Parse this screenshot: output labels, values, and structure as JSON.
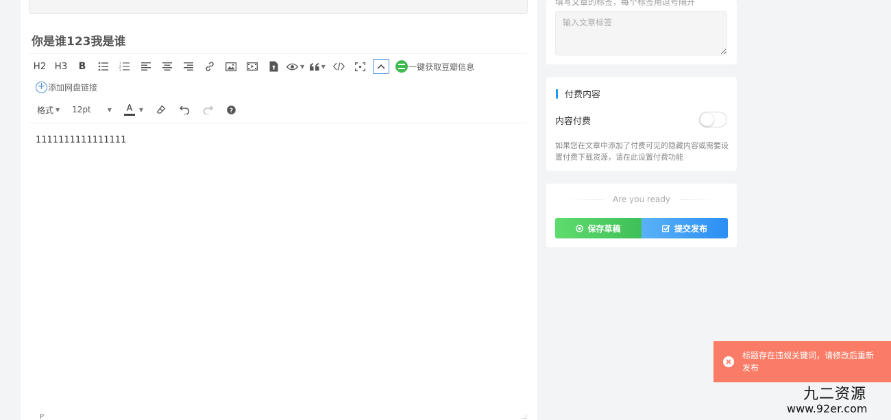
{
  "editor": {
    "title": "你是谁123我是谁",
    "toolbar": {
      "h2": "H2",
      "h3": "H3",
      "bold": "B",
      "douban_label": "一键获取豆瓣信息",
      "netdisk_label": "添加网盘链接",
      "format_label": "格式",
      "font_size": "12pt",
      "font_color": "A"
    },
    "content": "1111111111111111",
    "statusbar_path": "P"
  },
  "sidebar": {
    "tags": {
      "hint": "填写文章的标签，每个标签用逗号隔开",
      "placeholder": "输入文章标签"
    },
    "paid": {
      "heading": "付费内容",
      "toggle_label": "内容付费",
      "description": "如果您在文章中添加了付费可见的隐藏内容或需要设置付费下载资源，请在此设置付费功能"
    },
    "publish": {
      "ready_text": "Are you ready",
      "save_draft": "保存草稿",
      "submit": "提交发布"
    }
  },
  "toast": {
    "message": "标题存在违规关键词，请修改后重新发布"
  },
  "watermark": {
    "name": "九二资源",
    "url": "www.92er.com"
  },
  "colors": {
    "accent_blue": "#1e9bf0",
    "draft_green": "#4cd264",
    "publish_blue": "#3b9ef5",
    "toast_red": "#fa7c67"
  }
}
